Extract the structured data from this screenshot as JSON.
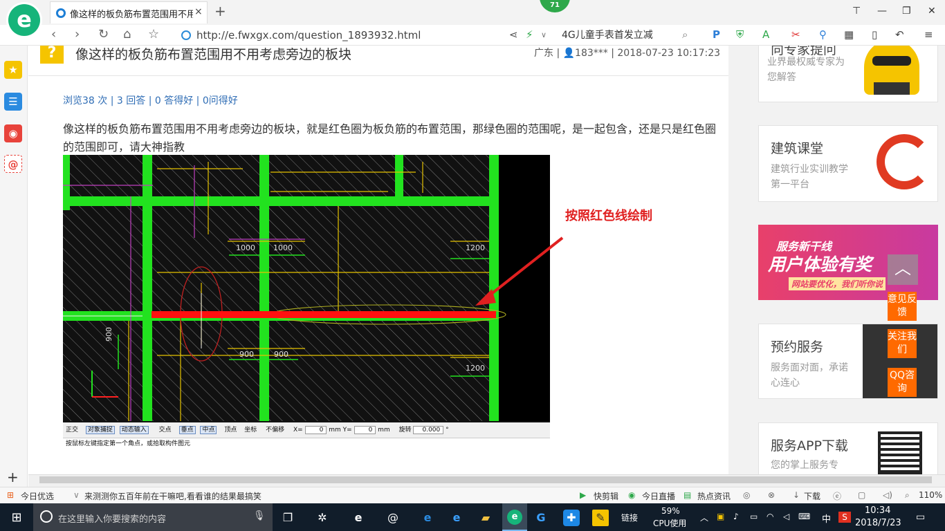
{
  "browser": {
    "logo": "e",
    "tab_title": "像这样的板负筋布置范围用不用考",
    "tab_close": "×",
    "new_tab": "+",
    "badge": "71",
    "url": "http://e.fwxgx.com/question_1893932.html",
    "search_text": "4G儿童手表首发立减",
    "win_controls": [
      "⊤",
      "—",
      "❐",
      "✕"
    ]
  },
  "question": {
    "title": "像这样的板负筋布置范围用不用考虑旁边的板块",
    "meta": "广东 | 👤183*** | 2018-07-23 10:17:23",
    "stats": "浏览38 次 | 3 回答 | 0 答得好 | 0问得好",
    "body": "像这样的板负筋布置范围用不用考虑旁边的板块，就是红色圈为板负筋的布置范围，那绿色圈的范围呢，是一起包含，还是只是红色圈的范围即可，请大神指教"
  },
  "cad": {
    "annotation": "按照红色线绘制",
    "dims": [
      "1000",
      "1000",
      "1200",
      "900",
      "900",
      "1200",
      "900"
    ],
    "toolbar": [
      "正交",
      "对象捕捉",
      "动态输入",
      "交点",
      "垂点",
      "中点",
      "顶点",
      "坐标",
      "不偏移",
      "X=",
      "0",
      "mm",
      "Y=",
      "0",
      "mm",
      "旋转",
      "0.000",
      "°"
    ],
    "prompt": "按鼠标左键指定第一个角点，或拾取构件图元"
  },
  "right": {
    "cards": [
      {
        "h": "向专家提问",
        "s": "业界最权威专家为您解答"
      },
      {
        "h": "建筑课堂",
        "s": "建筑行业实训教学第一平台"
      },
      {
        "h": "预约服务",
        "s": "服务面对面，承诺心连心"
      },
      {
        "h": "服务APP下载",
        "s": "您的掌上服务专"
      }
    ],
    "banner_title": "服务新干线",
    "banner_main": "用户体验有奖",
    "banner_sub": "网站要优化，我们听你说",
    "float_buttons": [
      "意见反馈",
      "关注我们",
      "QQ咨询"
    ]
  },
  "statusbar": {
    "left1": "今日优选",
    "left2": "来测测你五百年前在干嘛吧,看看谁的结果最搞笑",
    "items": [
      "快剪辑",
      "今日直播",
      "热点资讯",
      "下载"
    ],
    "zoom": "110%"
  },
  "taskbar": {
    "search_placeholder": "在这里输入你要搜索的内容",
    "link": "链接",
    "cpu_pct": "59%",
    "cpu_label": "CPU使用",
    "ime": "中",
    "time": "10:34",
    "date": "2018/7/23"
  },
  "colors": {
    "accent": "#2f6db5",
    "green": "#16b47a",
    "orange": "#ff6a00",
    "cad_green": "#22e21f",
    "cad_red": "#ff1010"
  }
}
